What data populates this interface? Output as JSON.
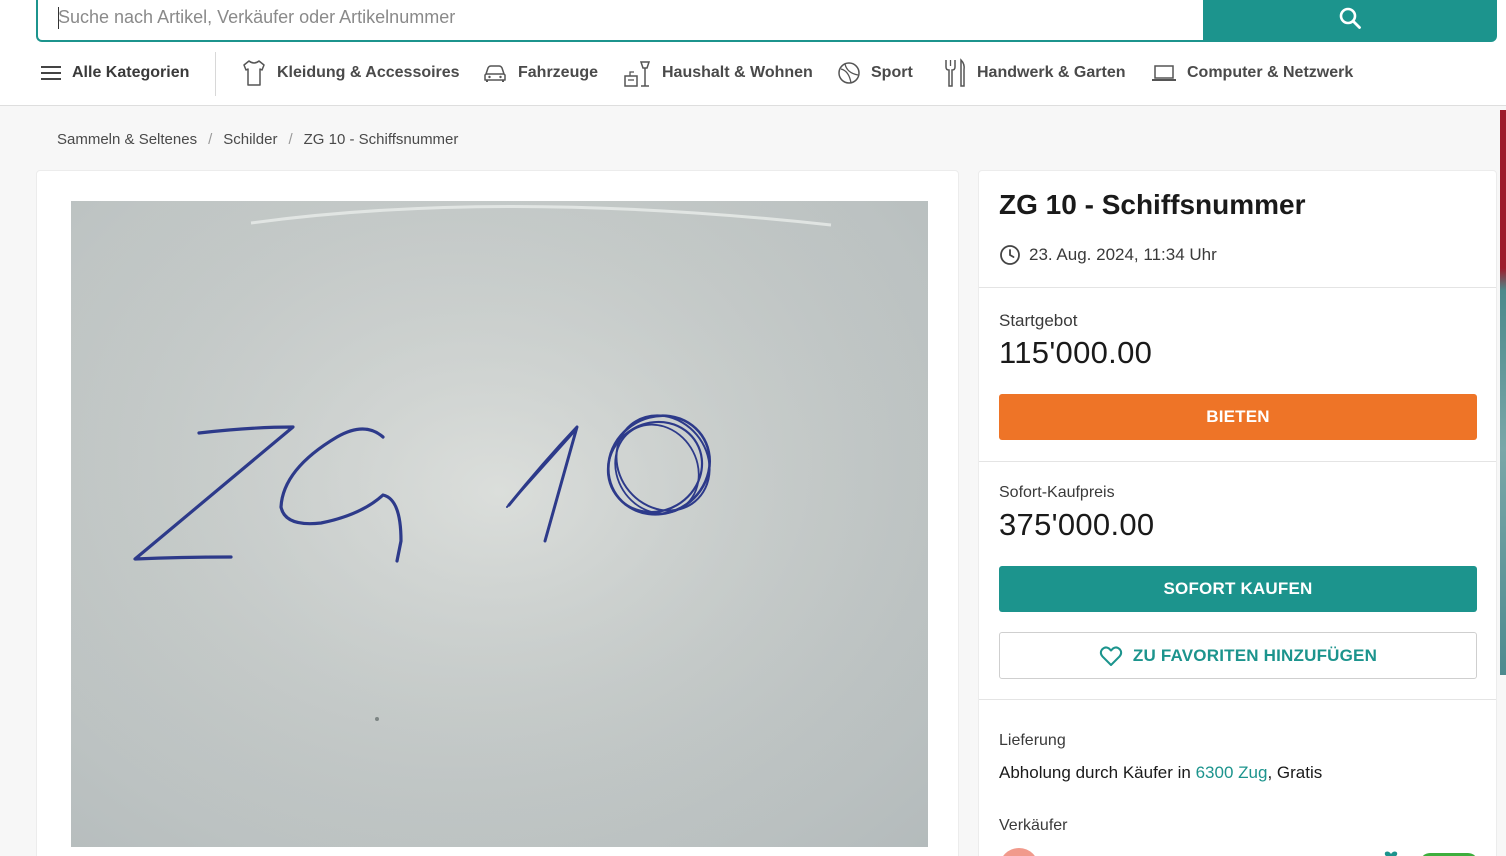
{
  "search": {
    "placeholder": "Suche nach Artikel, Verkäufer oder Artikelnummer",
    "icon": "search-icon"
  },
  "nav": {
    "all_categories": "Alle Kategorien",
    "items": [
      {
        "label": "Kleidung & Accessoires",
        "icon": "shirt-icon"
      },
      {
        "label": "Fahrzeuge",
        "icon": "car-icon"
      },
      {
        "label": "Haushalt & Wohnen",
        "icon": "household-icon"
      },
      {
        "label": "Sport",
        "icon": "ball-icon"
      },
      {
        "label": "Handwerk & Garten",
        "icon": "tools-icon"
      },
      {
        "label": "Computer & Netzwerk",
        "icon": "laptop-icon"
      }
    ]
  },
  "breadcrumb": [
    "Sammeln & Seltenes",
    "Schilder",
    "ZG 10 - Schiffsnummer"
  ],
  "listing": {
    "title": "ZG 10 - Schiffsnummer",
    "date": "23. Aug. 2024, 11:34 Uhr",
    "start_bid_label": "Startgebot",
    "start_bid": "115'000.00",
    "bid_button": "BIETEN",
    "buy_now_label": "Sofort-Kaufpreis",
    "buy_now_price": "375'000.00",
    "buy_now_button": "SOFORT KAUFEN",
    "favorite_button": "ZU FAVORITEN HINZUFÜGEN",
    "delivery_label": "Lieferung",
    "delivery_prefix": "Abholung durch Käufer in ",
    "delivery_location": "6300 Zug",
    "delivery_suffix": ", Gratis",
    "seller_label": "Verkäufer"
  },
  "colors": {
    "accent": "#1c948d",
    "bid": "#ee7427"
  }
}
